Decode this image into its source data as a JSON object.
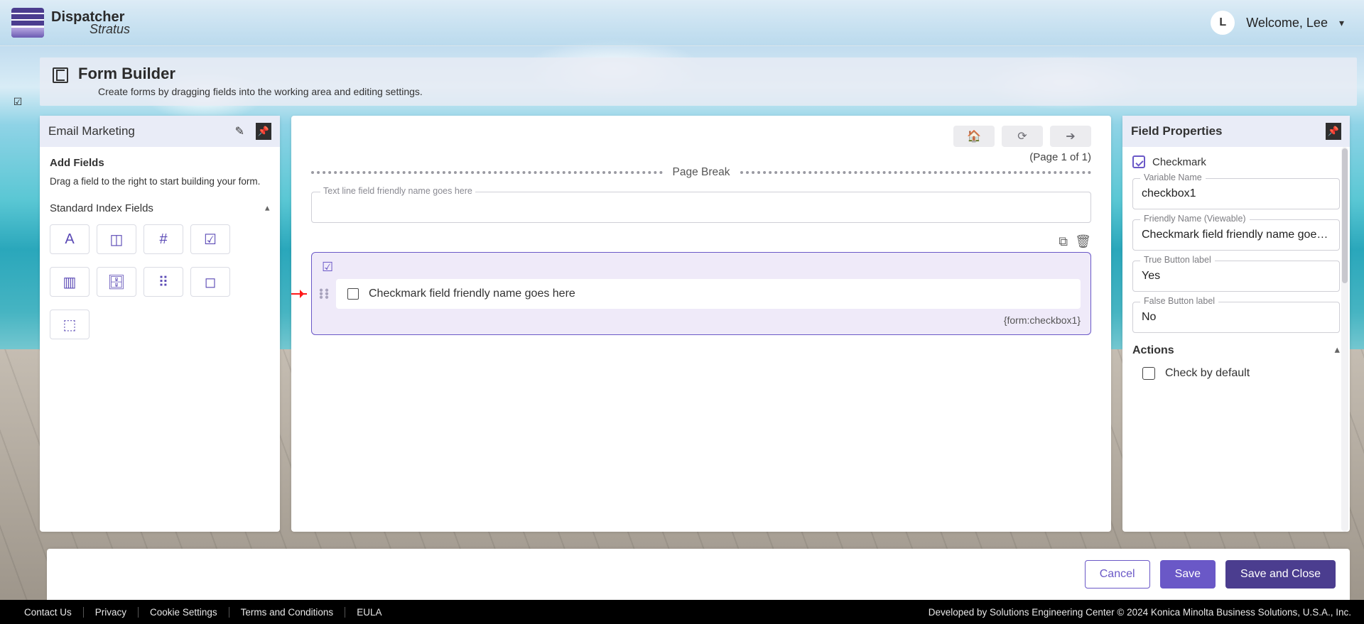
{
  "brand": {
    "title": "Dispatcher",
    "subtitle": "Stratus"
  },
  "user": {
    "initial": "L",
    "welcome": "Welcome, Lee"
  },
  "page": {
    "title": "Form Builder",
    "subtitle": "Create forms by dragging fields into the working area and editing settings."
  },
  "leftPanel": {
    "title": "Email Marketing",
    "addFieldsHeading": "Add Fields",
    "hint": "Drag a field to the right to start building your form.",
    "standardHeading": "Standard Index Fields",
    "tiles": [
      "A",
      "◫",
      "#",
      "☑",
      "▥",
      "🗄",
      "⠿",
      "◻",
      "⬚"
    ],
    "tileNames": [
      "text-field",
      "textarea-field",
      "number-field",
      "checkmark-field",
      "dropdown-field",
      "date-field",
      "group-field",
      "label-field",
      "pagebreak-field"
    ]
  },
  "canvas": {
    "pageCount": "(Page 1 of 1)",
    "pageBreakLabel": "Page Break",
    "textline": {
      "label": "Text line field friendly name goes here"
    },
    "selected": {
      "label": "Checkmark field friendly name goes here",
      "variable": "{form:checkbox1}"
    }
  },
  "props": {
    "title": "Field Properties",
    "typeLabel": "Checkmark",
    "variableName": {
      "label": "Variable Name",
      "value": "checkbox1"
    },
    "friendlyName": {
      "label": "Friendly Name (Viewable)",
      "value": "Checkmark field friendly name goes here"
    },
    "trueLabel": {
      "label": "True Button label",
      "value": "Yes"
    },
    "falseLabel": {
      "label": "False Button label",
      "value": "No"
    },
    "actionsHeading": "Actions",
    "checkByDefault": "Check by default"
  },
  "actions": {
    "cancel": "Cancel",
    "save": "Save",
    "saveClose": "Save and Close"
  },
  "footer": {
    "links": [
      "Contact Us",
      "Privacy",
      "Cookie Settings",
      "Terms and Conditions",
      "EULA"
    ],
    "copyright": "Developed by Solutions Engineering Center © 2024 Konica Minolta Business Solutions, U.S.A., Inc."
  }
}
